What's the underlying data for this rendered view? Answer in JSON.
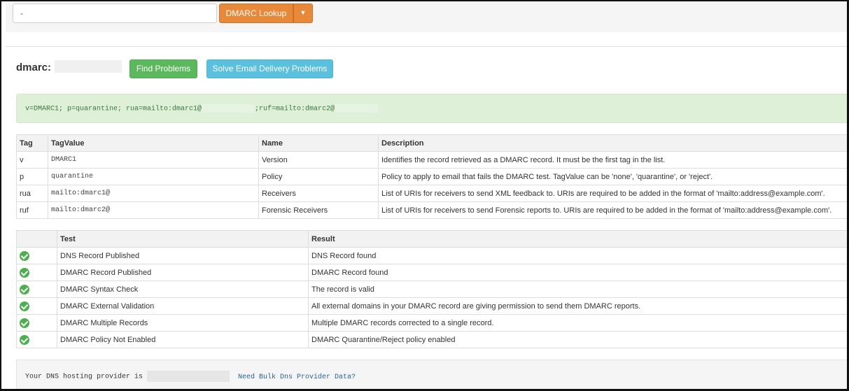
{
  "search": {
    "value": "-",
    "lookup_label": "DMARC Lookup",
    "caret": "▼"
  },
  "header": {
    "dmarc_label": "dmarc:",
    "find_problems": "Find Problems",
    "solve_problems": "Solve Email Delivery Problems"
  },
  "record": {
    "part1": "v=DMARC1; p=quarantine; rua=mailto:dmarc1@",
    "part2": ";ruf=mailto:dmarc2@"
  },
  "tag_table": {
    "headers": [
      "Tag",
      "TagValue",
      "Name",
      "Description"
    ],
    "rows": [
      {
        "tag": "v",
        "value": "DMARC1",
        "name": "Version",
        "description": "Identifies the record retrieved as a DMARC record. It must be the first tag in the list."
      },
      {
        "tag": "p",
        "value": "quarantine",
        "name": "Policy",
        "description": "Policy to apply to email that fails the DMARC test. TagValue can be 'none', 'quarantine', or 'reject'."
      },
      {
        "tag": "rua",
        "value": "mailto:dmarc1@",
        "name": "Receivers",
        "description": "List of URIs for receivers to send XML feedback to. URIs are required to be added in the format of 'mailto:address@example.com'."
      },
      {
        "tag": "ruf",
        "value": "mailto:dmarc2@",
        "name": "Forensic Receivers",
        "description": "List of URIs for receivers to send Forensic reports to. URIs are required to be added in the format of 'mailto:address@example.com'."
      }
    ]
  },
  "test_table": {
    "headers": [
      "",
      "Test",
      "Result"
    ],
    "status_icon": "check-circle-icon",
    "rows": [
      {
        "test": "DNS Record Published",
        "result": "DNS Record found"
      },
      {
        "test": "DMARC Record Published",
        "result": "DMARC Record found"
      },
      {
        "test": "DMARC Syntax Check",
        "result": "The record is valid"
      },
      {
        "test": "DMARC External Validation",
        "result": "All external domains in your DMARC record are giving permission to send them DMARC reports."
      },
      {
        "test": "DMARC Multiple Records",
        "result": "Multiple DMARC records corrected to a single record."
      },
      {
        "test": "DMARC Policy Not Enabled",
        "result": "DMARC Quarantine/Reject policy enabled"
      }
    ]
  },
  "provider": {
    "text": "Your DNS hosting provider is",
    "link": "Need Bulk Dns Provider Data?"
  },
  "colors": {
    "lookup_orange": "#e8893a",
    "find_green": "#5cb85c",
    "solve_blue": "#5bc0de",
    "record_bg": "#dff0d8",
    "check_green": "#4cae4c"
  }
}
